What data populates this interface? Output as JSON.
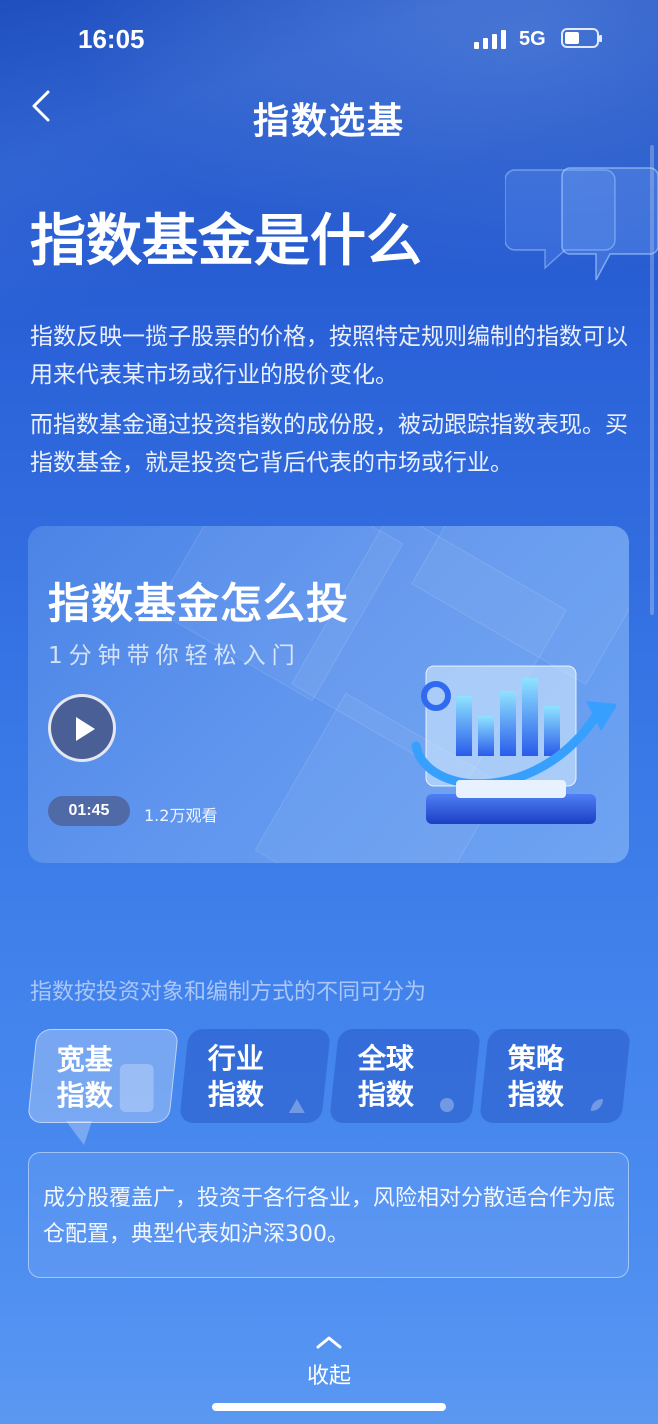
{
  "status_bar": {
    "time": "16:05",
    "network": "5G"
  },
  "nav": {
    "title": "指数选基"
  },
  "intro": {
    "heading": "指数基金是什么",
    "paragraph1": "指数反映一揽子股票的价格，按照特定规则编制的指数可以用来代表某市场或行业的股价变化。",
    "paragraph2": "而指数基金通过投资指数的成份股，被动跟踪指数表现。买指数基金，就是投资它背后代表的市场或行业。"
  },
  "video": {
    "title": "指数基金怎么投",
    "subtitle": "1分钟带你轻松入门",
    "duration": "01:45",
    "views": "1.2万观看"
  },
  "categories": {
    "caption": "指数按投资对象和编制方式的不同可分为",
    "tabs": [
      {
        "label": "宽基\n指数",
        "active": true
      },
      {
        "label": "行业\n指数",
        "active": false
      },
      {
        "label": "全球\n指数",
        "active": false
      },
      {
        "label": "策略\n指数",
        "active": false
      }
    ],
    "description": "成分股覆盖广，投资于各行各业，风险相对分散适合作为底仓配置，典型代表如沪深300。"
  },
  "footer": {
    "collapse_label": "收起"
  },
  "colors": {
    "accent": "#2b62d9",
    "tab_inactive": "#2f6ad8"
  }
}
